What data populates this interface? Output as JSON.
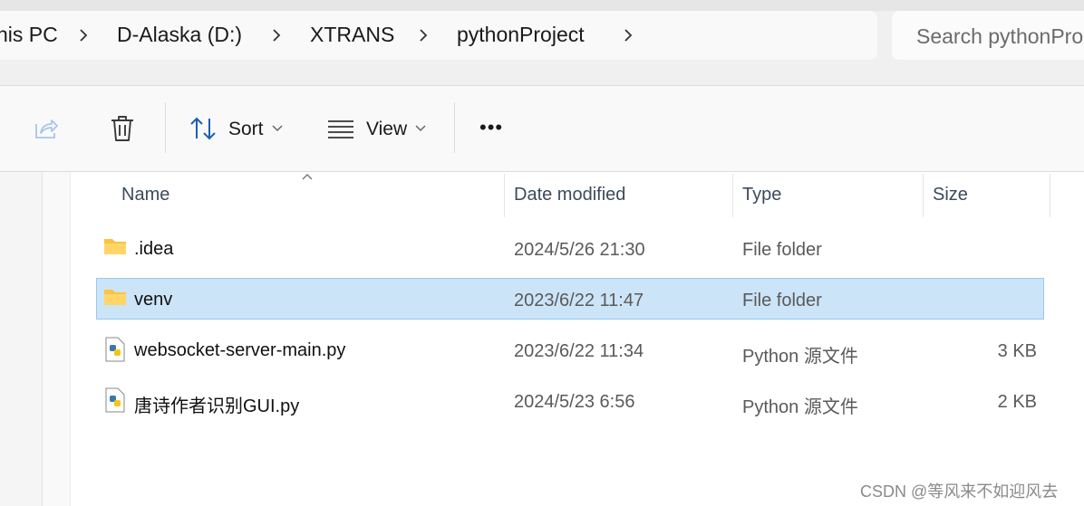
{
  "address": {
    "breadcrumbs": [
      "his PC",
      "D-Alaska (D:)",
      "XTRANS",
      "pythonProject"
    ],
    "search_placeholder": "Search pythonPro"
  },
  "toolbar": {
    "share_icon": "share-icon",
    "delete_icon": "delete-icon",
    "sort_label": "Sort",
    "view_label": "View",
    "more_label": "•••"
  },
  "columns": {
    "name": "Name",
    "date": "Date modified",
    "type": "Type",
    "size": "Size"
  },
  "files": [
    {
      "name": ".idea",
      "date": "2024/5/26 21:30",
      "type": "File folder",
      "size": "",
      "icon": "folder-icon",
      "selected": false
    },
    {
      "name": "venv",
      "date": "2023/6/22 11:47",
      "type": "File folder",
      "size": "",
      "icon": "folder-icon",
      "selected": true
    },
    {
      "name": "websocket-server-main.py",
      "date": "2023/6/22 11:34",
      "type": "Python 源文件",
      "size": "3 KB",
      "icon": "python-file-icon",
      "selected": false
    },
    {
      "name": "唐诗作者识别GUI.py",
      "date": "2024/5/23 6:56",
      "type": "Python 源文件",
      "size": "2 KB",
      "icon": "python-file-icon",
      "selected": false
    }
  ],
  "watermark": "CSDN @等风来不如迎风去",
  "colors": {
    "selection_bg": "#cce4f7",
    "selection_border": "#99c9ef",
    "folder": "#f8c444"
  }
}
